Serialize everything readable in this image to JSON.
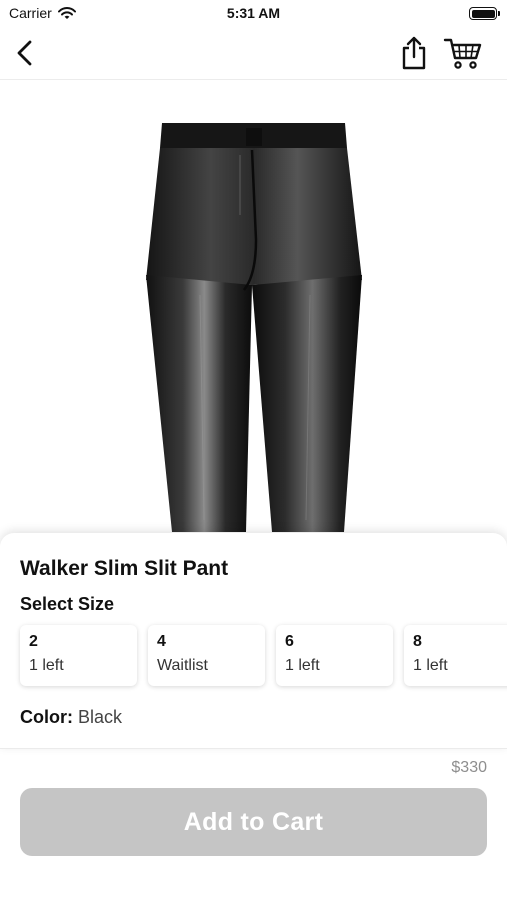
{
  "status_bar": {
    "carrier": "Carrier",
    "time": "5:31 AM"
  },
  "nav": {
    "back_icon": "chevron-left-icon",
    "share_icon": "share-icon",
    "cart_icon": "cart-icon"
  },
  "product": {
    "image": "black-leather-pants",
    "title": "Walker Slim Slit Pant",
    "size_heading": "Select Size",
    "sizes": [
      {
        "value": "2",
        "stock": "1 left"
      },
      {
        "value": "4",
        "stock": "Waitlist"
      },
      {
        "value": "6",
        "stock": "1 left"
      },
      {
        "value": "8",
        "stock": "1 left"
      }
    ],
    "color_label": "Color:",
    "color_value": "Black",
    "price": "$330"
  },
  "actions": {
    "add_to_cart_label": "Add to Cart",
    "add_to_cart_color": "#c5c5c5"
  }
}
